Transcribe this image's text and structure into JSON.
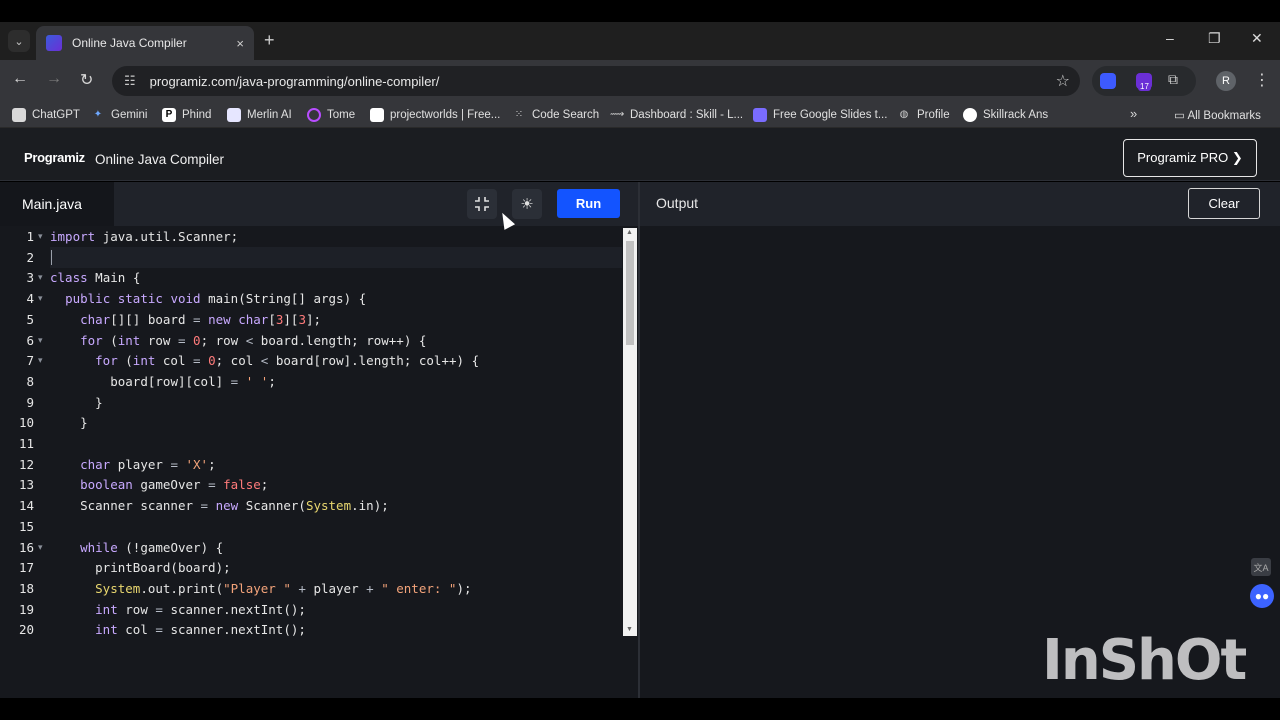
{
  "browser": {
    "tab_title": "Online Java Compiler",
    "tab_close": "×",
    "new_tab": "+",
    "url": "programiz.com/java-programming/online-compiler/",
    "extension_badge": "17",
    "profile_initial": "R",
    "window_controls": {
      "minimize": "–",
      "maximize": "❐",
      "close": "✕"
    },
    "nav": {
      "back": "←",
      "forward": "→",
      "reload": "↻"
    }
  },
  "bookmarks": [
    {
      "label": "ChatGPT",
      "icon": "chatgpt-icon",
      "color": "#d9d9d9"
    },
    {
      "label": "Gemini",
      "icon": "gemini-icon",
      "color": "#6ea8ff"
    },
    {
      "label": "Phind",
      "icon": "phind-icon",
      "color": "#ffffff"
    },
    {
      "label": "Merlin AI",
      "icon": "merlin-icon",
      "color": "#e6e6ff"
    },
    {
      "label": "Tome",
      "icon": "tome-icon",
      "color": "#b84dff"
    },
    {
      "label": "projectworlds | Free...",
      "icon": "projectworlds-icon",
      "color": "#ffffff"
    },
    {
      "label": "Code Search",
      "icon": "code-search-icon",
      "color": "#cfcfcf"
    },
    {
      "label": "Dashboard : Skill - L...",
      "icon": "dashboard-icon",
      "color": "#cfcfcf"
    },
    {
      "label": "Free Google Slides t...",
      "icon": "slides-icon",
      "color": "#7a6cff"
    },
    {
      "label": "Profile",
      "icon": "globe-icon",
      "color": "#cfcfcf"
    },
    {
      "label": "Skillrack Ans",
      "icon": "github-icon",
      "color": "#ffffff"
    }
  ],
  "bookmarks_more": "»",
  "all_bookmarks": "All Bookmarks",
  "app": {
    "logo": "Programiz",
    "title": "Online Java Compiler",
    "pro_button": "Programiz PRO ❯",
    "file_tab": "Main.java",
    "run_button": "Run",
    "output_title": "Output",
    "clear_button": "Clear",
    "accent_color": "#1354ff"
  },
  "editor": {
    "lines": [
      {
        "n": "1",
        "fold": true,
        "code": "import java.util.Scanner;"
      },
      {
        "n": "2",
        "fold": false,
        "code": ""
      },
      {
        "n": "3",
        "fold": true,
        "code": "class Main {"
      },
      {
        "n": "4",
        "fold": true,
        "code": "  public static void main(String[] args) {"
      },
      {
        "n": "5",
        "fold": false,
        "code": "    char[][] board = new char[3][3];"
      },
      {
        "n": "6",
        "fold": true,
        "code": "    for (int row = 0; row < board.length; row++) {"
      },
      {
        "n": "7",
        "fold": true,
        "code": "      for (int col = 0; col < board[row].length; col++) {"
      },
      {
        "n": "8",
        "fold": false,
        "code": "        board[row][col] = ' ';"
      },
      {
        "n": "9",
        "fold": false,
        "code": "      }"
      },
      {
        "n": "10",
        "fold": false,
        "code": "    }"
      },
      {
        "n": "11",
        "fold": false,
        "code": ""
      },
      {
        "n": "12",
        "fold": false,
        "code": "    char player = 'X';"
      },
      {
        "n": "13",
        "fold": false,
        "code": "    boolean gameOver = false;"
      },
      {
        "n": "14",
        "fold": false,
        "code": "    Scanner scanner = new Scanner(System.in);"
      },
      {
        "n": "15",
        "fold": false,
        "code": ""
      },
      {
        "n": "16",
        "fold": true,
        "code": "    while (!gameOver) {"
      },
      {
        "n": "17",
        "fold": false,
        "code": "      printBoard(board);"
      },
      {
        "n": "18",
        "fold": false,
        "code": "      System.out.print(\"Player \" + player + \" enter: \");"
      },
      {
        "n": "19",
        "fold": false,
        "code": "      int row = scanner.nextInt();"
      },
      {
        "n": "20",
        "fold": false,
        "code": "      int col = scanner.nextInt();"
      }
    ]
  },
  "watermark": "InShOt"
}
